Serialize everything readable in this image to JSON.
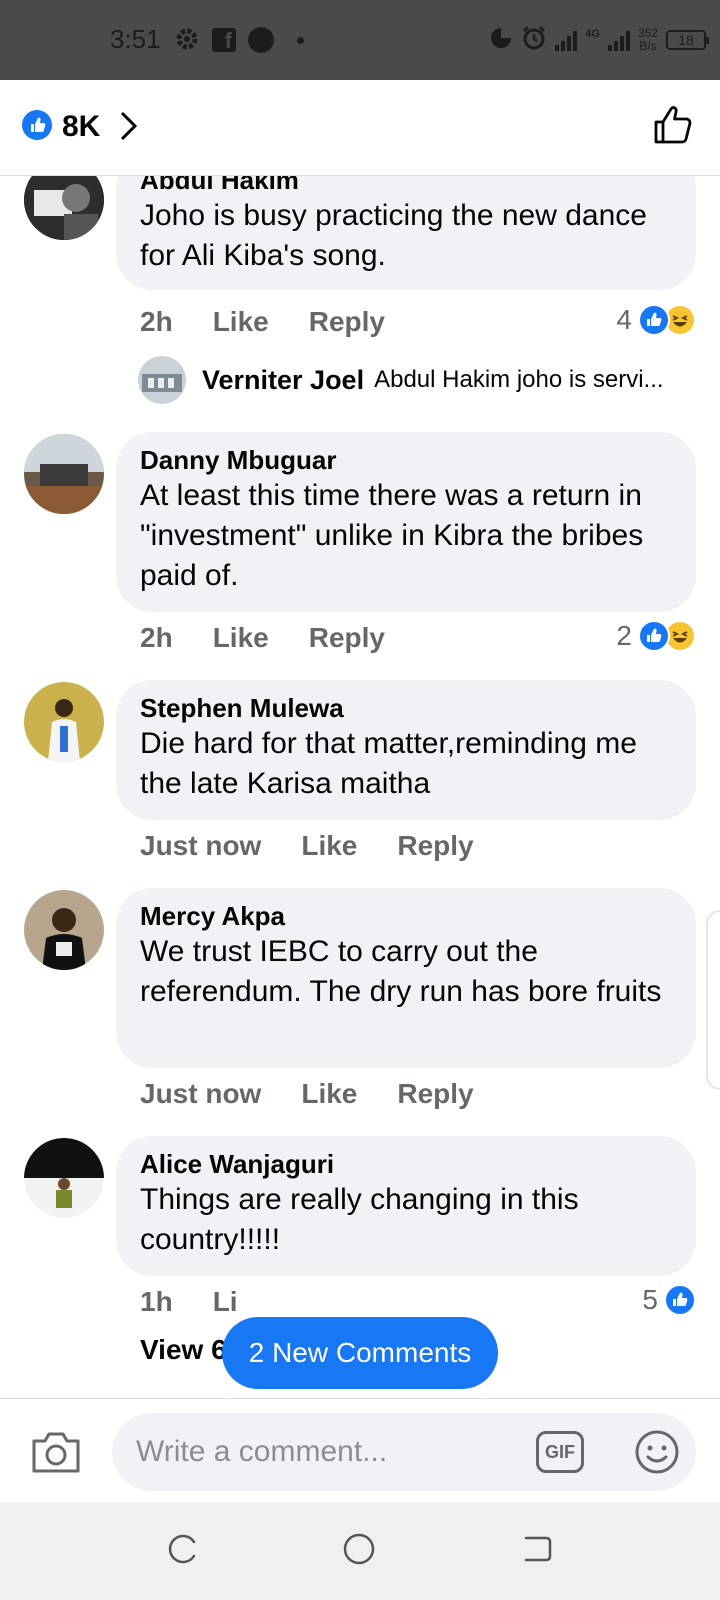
{
  "status_bar": {
    "time": "3:51",
    "network_type": "4G",
    "speed_value": "352",
    "speed_unit": "B/s",
    "battery": "18",
    "icons": [
      "gear-icon",
      "facebook-icon",
      "circle-icon",
      "dot-icon",
      "data-saver-icon",
      "alarm-icon",
      "signal-icon",
      "battery-icon"
    ]
  },
  "header": {
    "reaction_count": "8K",
    "icons": [
      "like-badge-icon",
      "chevron-right-icon",
      "thumbs-up-icon"
    ]
  },
  "comments": [
    {
      "author": "Abdul Hakim",
      "text": "Joho is busy practicing the new dance for Ali Kiba's song.",
      "time": "2h",
      "like_label": "Like",
      "reply_label": "Reply",
      "reaction_count": "4",
      "reactions": [
        "like",
        "haha"
      ],
      "reply_preview": {
        "author": "Verniter Joel",
        "text": "Abdul Hakim joho is servi..."
      }
    },
    {
      "author": "Danny Mbuguar",
      "text": "At least this time there was a return in \"investment\" unlike in Kibra the bribes paid of.",
      "time": "2h",
      "like_label": "Like",
      "reply_label": "Reply",
      "reaction_count": "2",
      "reactions": [
        "like",
        "haha"
      ]
    },
    {
      "author": "Stephen Mulewa",
      "text": "Die hard for that matter,reminding me the late Karisa  maitha",
      "time": "Just now",
      "like_label": "Like",
      "reply_label": "Reply"
    },
    {
      "author": "Mercy Akpa",
      "text": "We trust IEBC to carry out the referendum. The dry run has bore fruits",
      "time": "Just now",
      "like_label": "Like",
      "reply_label": "Reply"
    },
    {
      "author": "Alice Wanjaguri",
      "text": "Things are really changing in this country!!!!!",
      "time": "1h",
      "like_label": "Li",
      "reaction_count": "5",
      "reactions": [
        "like"
      ],
      "view_previous": "View 6 p"
    }
  ],
  "new_comments_button": "2 New Comments",
  "composer": {
    "placeholder": "Write a comment...",
    "gif_label": "GIF",
    "icons": [
      "camera-icon",
      "gif-icon",
      "emoji-icon"
    ]
  },
  "colors": {
    "accent": "#1877f2",
    "bubble": "#f0f2f5",
    "meta_text": "#65676b",
    "status_bar": "#4a4a4a"
  }
}
